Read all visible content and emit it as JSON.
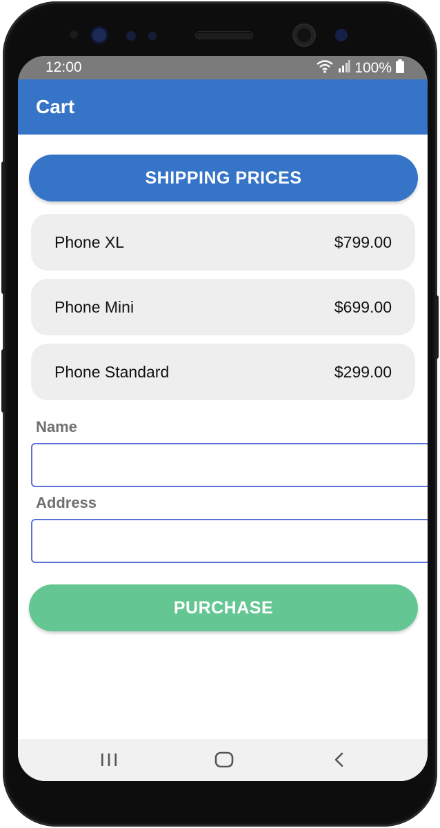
{
  "status_bar": {
    "time": "12:00",
    "battery": "100%",
    "icons": [
      "wifi-icon",
      "signal-icon",
      "battery-icon"
    ]
  },
  "app_bar": {
    "title": "Cart",
    "color": "#3674c7"
  },
  "shipping_button": {
    "label": "SHIPPING PRICES",
    "color": "#3674c7"
  },
  "cart_items": [
    {
      "name": "Phone XL",
      "price": "$799.00"
    },
    {
      "name": "Phone Mini",
      "price": "$699.00"
    },
    {
      "name": "Phone Standard",
      "price": "$299.00"
    }
  ],
  "form": {
    "name_label": "Name",
    "name_value": "",
    "address_label": "Address",
    "address_value": ""
  },
  "purchase_button": {
    "label": "PURCHASE",
    "color": "#64c793"
  },
  "nav_bar": {
    "icons": [
      "recents-icon",
      "home-icon",
      "back-icon"
    ]
  }
}
